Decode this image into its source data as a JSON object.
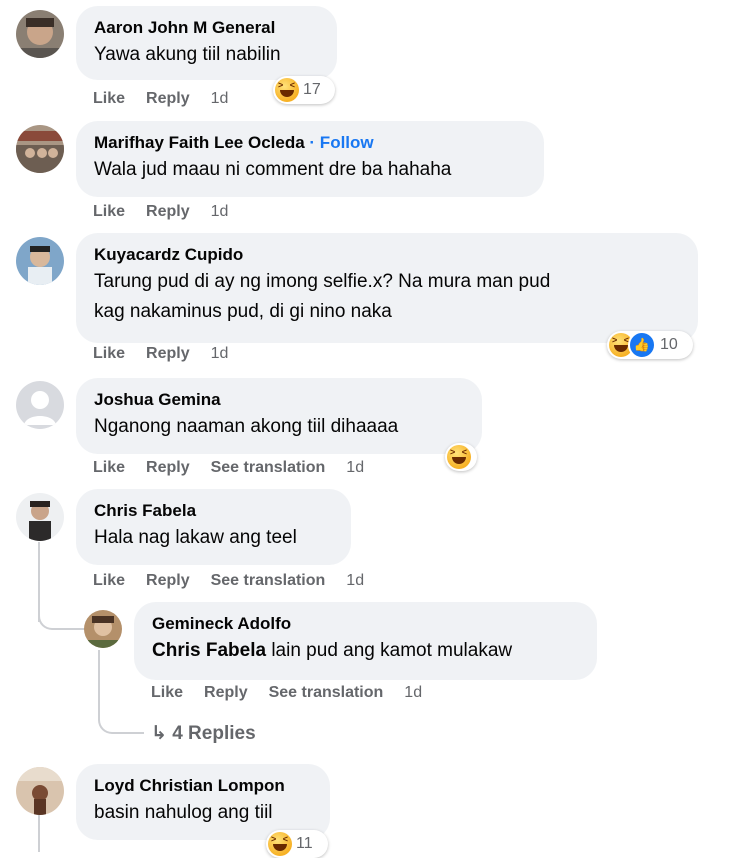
{
  "actions": {
    "like": "Like",
    "reply": "Reply",
    "see_translation": "See translation"
  },
  "comments": [
    {
      "name": "Aaron John M General",
      "text": "Yawa akung tiil nabilin",
      "time": "1d",
      "reactions": {
        "icons": [
          "haha-icon"
        ],
        "count": "17"
      }
    },
    {
      "name": "Marifhay Faith Lee Ocleda",
      "follow": "· Follow",
      "text": "Wala jud maau ni comment dre ba hahaha",
      "time": "1d"
    },
    {
      "name": "Kuyacardz Cupido",
      "text_line1": "Tarung pud di ay ng imong selfie.x? Na mura man pud",
      "text_line2": "kag nakaminus pud, di gi nino naka",
      "time": "1d",
      "reactions": {
        "icons": [
          "haha-icon",
          "like-icon"
        ],
        "count": "10"
      }
    },
    {
      "name": "Joshua Gemina",
      "text": "Nganong naaman akong tiil dihaaaa",
      "time": "1d",
      "reactions": {
        "icons": [
          "haha-icon"
        ],
        "count": ""
      }
    },
    {
      "name": "Chris Fabela",
      "text": "Hala nag lakaw ang teel",
      "time": "1d"
    },
    {
      "name": "Gemineck Adolfo",
      "mention": "Chris Fabela",
      "text": "lain pud ang kamot mulakaw",
      "time": "1d"
    },
    {
      "name": "Loyd Christian Lompon",
      "text": "basin nahulog ang tiil",
      "reactions": {
        "icons": [
          "haha-icon"
        ],
        "count": "11"
      }
    }
  ],
  "replies_link": "↳ 4 Replies"
}
